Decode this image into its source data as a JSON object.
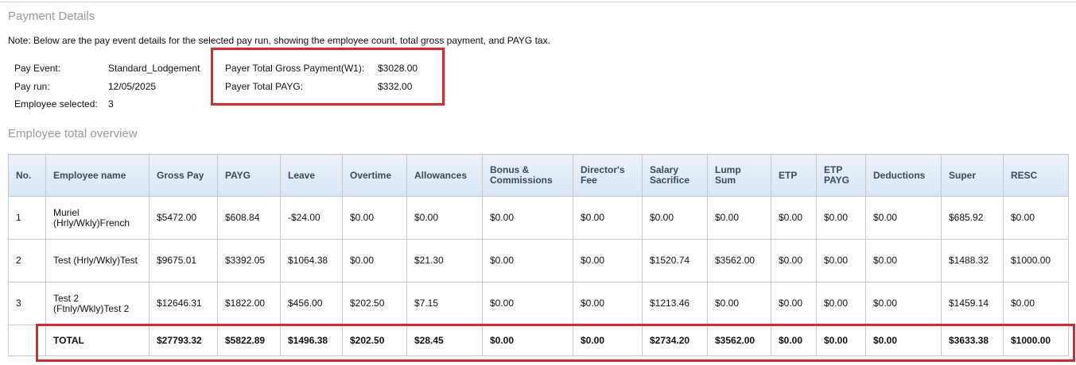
{
  "payment_details": {
    "title": "Payment Details",
    "note": "Note: Below are the pay event details for the selected pay run, showing the employee count, total gross payment, and PAYG tax.",
    "pay_event_label": "Pay Event:",
    "pay_event_value": "Standard_Lodgement",
    "pay_run_label": "Pay run:",
    "pay_run_value": "12/05/2025",
    "employee_selected_label": "Employee selected:",
    "employee_selected_value": "3",
    "payer_gross_label": "Payer Total Gross Payment(W1):",
    "payer_gross_value": "$3028.00",
    "payer_payg_label": "Payer Total PAYG:",
    "payer_payg_value": "$332.00"
  },
  "overview": {
    "title": "Employee total overview",
    "columns": [
      "No.",
      "Employee name",
      "Gross Pay",
      "PAYG",
      "Leave",
      "Overtime",
      "Allowances",
      "Bonus & Commissions",
      "Director's Fee",
      "Salary Sacrifice",
      "Lump Sum",
      "ETP",
      "ETP PAYG",
      "Deductions",
      "Super",
      "RESC"
    ],
    "rows": [
      [
        "1",
        "Muriel (Hrly/Wkly)French",
        "$5472.00",
        "$608.84",
        "-$24.00",
        "$0.00",
        "$0.00",
        "$0.00",
        "$0.00",
        "$0.00",
        "$0.00",
        "$0.00",
        "$0.00",
        "$0.00",
        "$685.92",
        "$0.00"
      ],
      [
        "2",
        "Test (Hrly/Wkly)Test",
        "$9675.01",
        "$3392.05",
        "$1064.38",
        "$0.00",
        "$21.30",
        "$0.00",
        "$0.00",
        "$1520.74",
        "$3562.00",
        "$0.00",
        "$0.00",
        "$0.00",
        "$1488.32",
        "$1000.00"
      ],
      [
        "3",
        "Test 2 (Ftnly/Wkly)Test 2",
        "$12646.31",
        "$1822.00",
        "$456.00",
        "$202.50",
        "$7.15",
        "$0.00",
        "$0.00",
        "$1213.46",
        "$0.00",
        "$0.00",
        "$0.00",
        "$0.00",
        "$1459.14",
        "$0.00"
      ]
    ],
    "total": [
      "",
      "TOTAL",
      "$27793.32",
      "$5822.89",
      "$1496.38",
      "$202.50",
      "$28.45",
      "$0.00",
      "$0.00",
      "$2734.20",
      "$3562.00",
      "$0.00",
      "$0.00",
      "$0.00",
      "$3633.38",
      "$1000.00"
    ]
  },
  "colors": {
    "highlight": "#e0242a",
    "header_bg": "#dce8f5",
    "section_title": "#9a9a9a"
  }
}
